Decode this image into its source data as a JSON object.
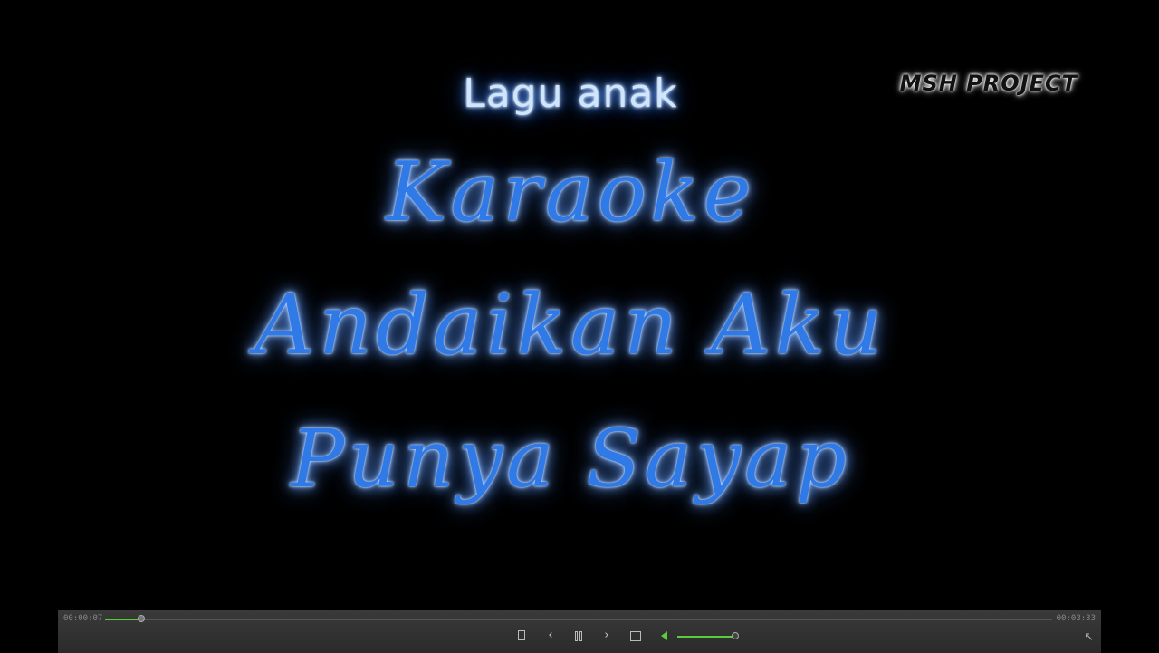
{
  "video": {
    "subtitle": "Lagu  anak",
    "watermark": "MSH PROJECT",
    "title_lines": [
      "Karaoke",
      "Andaikan Aku",
      "Punya Sayap"
    ]
  },
  "player": {
    "current_time": "00:00:07",
    "total_time": "00:03:33",
    "progress_fraction": 0.038,
    "volume_fraction": 1.0,
    "icons": {
      "open": "open-file-icon",
      "prev": "previous-icon",
      "pause": "pause-icon",
      "next": "next-icon",
      "stop": "stop-icon",
      "volume": "volume-icon",
      "corner": "resize-arrow-icon"
    },
    "glyphs": {
      "prev": "‹",
      "next": "›",
      "corner": "↖"
    },
    "accent_color": "#5bcc3a"
  }
}
